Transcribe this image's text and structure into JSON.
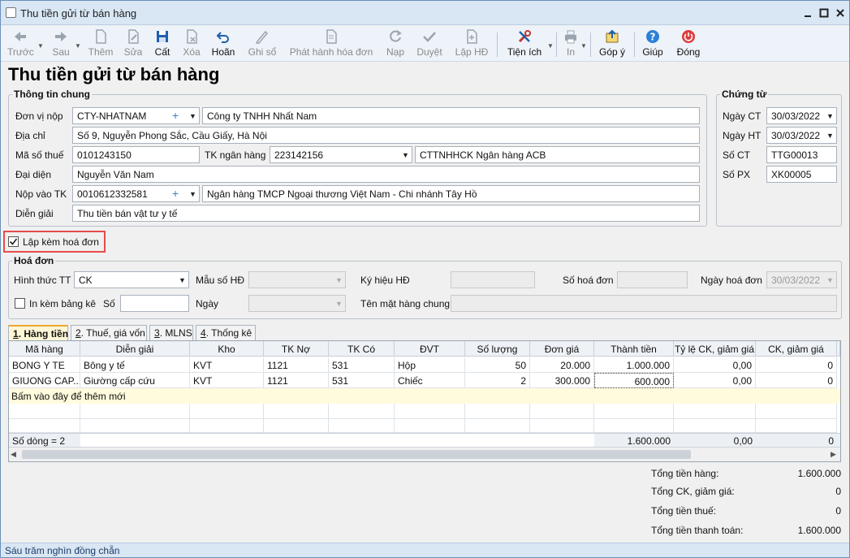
{
  "window": {
    "title": "Thu tiền gửi từ bán hàng"
  },
  "toolbar": {
    "back": "Trước",
    "forward": "Sau",
    "add": "Thêm",
    "edit": "Sửa",
    "save": "Cất",
    "delete": "Xóa",
    "undo": "Hoãn",
    "post": "Ghi sổ",
    "issue_invoice": "Phát hành hóa đơn",
    "reload": "Nạp",
    "approve": "Duyệt",
    "make_invoice": "Lập HĐ",
    "utilities": "Tiện ích",
    "print": "In",
    "feedback": "Góp ý",
    "help": "Giúp",
    "close": "Đóng"
  },
  "page_title": "Thu tiền gửi từ bán hàng",
  "general": {
    "legend": "Thông tin chung",
    "payer_label": "Đơn vị nộp",
    "payer_code": "CTY-NHATNAM",
    "payer_name": "Công ty TNHH Nhất Nam",
    "address_label": "Địa chỉ",
    "address": "Số 9, Nguyễn Phong Sắc, Cầu Giấy, Hà Nội",
    "tax_label": "Mã số thuế",
    "tax_code": "0101243150",
    "bank_acc_label": "TK ngân hàng",
    "bank_acc": "223142156",
    "bank_acc_name": "CTTNHHCK Ngân hàng ACB",
    "rep_label": "Đại diện",
    "rep": "Nguyễn Văn Nam",
    "deposit_label": "Nộp vào TK",
    "deposit_acc": "0010612332581",
    "deposit_bank": "Ngân hàng TMCP Ngoại thương Việt Nam - Chi nhánh Tây Hồ",
    "desc_label": "Diễn giải",
    "desc": "Thu tiền bán vật tư y tế"
  },
  "voucher": {
    "legend": "Chứng từ",
    "date_ct_label": "Ngày CT",
    "date_ct": "30/03/2022",
    "date_ht_label": "Ngày HT",
    "date_ht": "30/03/2022",
    "no_ct_label": "Số CT",
    "no_ct": "TTG00013",
    "no_px_label": "Số PX",
    "no_px": "XK00005"
  },
  "invoice_checkbox": {
    "label": "Lập kèm hoá đơn",
    "checked": true
  },
  "invoice": {
    "legend": "Hoá đơn",
    "pay_method_label": "Hình thức TT",
    "pay_method": "CK",
    "template_label": "Mẫu số HĐ",
    "symbol_label": "Ký hiệu HĐ",
    "number_label": "Số hoá đơn",
    "date_label": "Ngày hoá đơn",
    "date": "30/03/2022",
    "print_list_label": "In kèm bảng kê",
    "list_no_label": "Số",
    "list_date_label": "Ngày",
    "common_item_label": "Tên mặt hàng chung"
  },
  "tabs": [
    {
      "key": "1",
      "label": ". Hàng tiền"
    },
    {
      "key": "2",
      "label": ". Thuế, giá vốn"
    },
    {
      "key": "3",
      "label": ". MLNS"
    },
    {
      "key": "4",
      "label": ". Thống kê"
    }
  ],
  "grid": {
    "columns": [
      "Mã hàng",
      "Diễn giải",
      "Kho",
      "TK Nợ",
      "TK Có",
      "ĐVT",
      "Số lượng",
      "Đơn giá",
      "Thành tiền",
      "Tỷ lệ CK, giảm giá",
      "CK, giảm  giá"
    ],
    "rows": [
      [
        "BONG Y TE",
        "Bông y tế",
        "KVT",
        "1121",
        "531",
        "Hộp",
        "50",
        "20.000",
        "1.000.000",
        "0,00",
        "0"
      ],
      [
        "GIUONG CAP...",
        "Giường cấp cứu",
        "KVT",
        "1121",
        "531",
        "Chiếc",
        "2",
        "300.000",
        "600.000",
        "0,00",
        "0"
      ]
    ],
    "new_row_hint": "Bấm vào đây để thêm mới",
    "footer": {
      "count": "Số dòng = 2",
      "total_amount": "1.600.000",
      "total_rate": "0,00",
      "total_discount": "0"
    }
  },
  "totals": {
    "goods_label": "Tổng tiền hàng:",
    "goods": "1.600.000",
    "discount_label": "Tổng CK, giảm giá:",
    "discount": "0",
    "tax_label": "Tổng tiền thuế:",
    "tax": "0",
    "pay_label": "Tổng tiền thanh toán:",
    "pay": "1.600.000"
  },
  "status": "Sáu trăm nghìn đồng chẵn",
  "colors": {
    "accent": "#1f5fae",
    "highlight_box": "#e74c4c",
    "close_red": "#e03a3a"
  }
}
